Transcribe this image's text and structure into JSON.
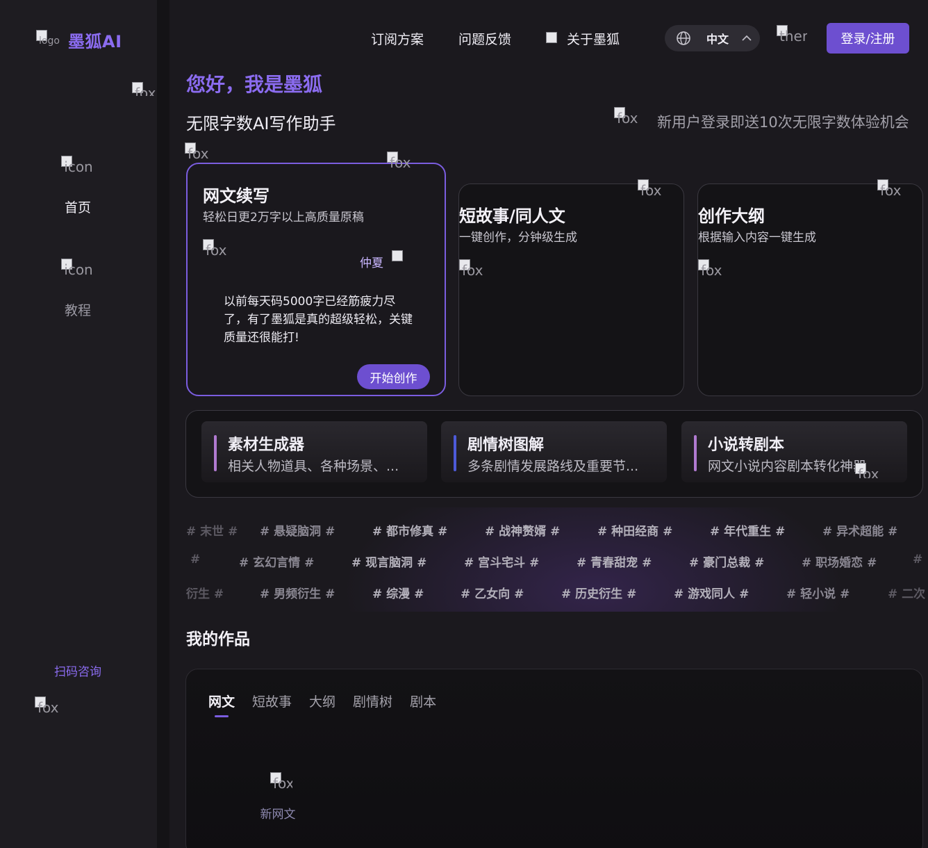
{
  "brand": {
    "name": "墨狐AI",
    "logo_alt": "logo"
  },
  "sidebar": {
    "items": [
      {
        "label": "首页",
        "icon_alt": "icon"
      },
      {
        "label": "教程",
        "icon_alt": "icon"
      }
    ],
    "consult_label": "扫码咨询",
    "consult_img_alt": "fox"
  },
  "header": {
    "nav": [
      "订阅方案",
      "问题反馈",
      "关于墨狐"
    ],
    "lang_label": "中文",
    "theme_alt": "ther",
    "login_label": "登录/注册"
  },
  "hero": {
    "greeting": "您好，我是墨狐",
    "subtitle": "无限字数AI写作助手",
    "promo": "新用户登录即送10次无限字数体验机会",
    "img_alt": "fox"
  },
  "cards": [
    {
      "title": "网文续写",
      "desc": "轻松日更2万字以上高质量原稿",
      "quote_name": "仲夏",
      "quote": "以前每天码5000字已经筋疲力尽了，有了墨狐是真的超级轻松，关键质量还很能打!",
      "button": "开始创作",
      "img_alt": "fox"
    },
    {
      "title": "短故事/同人文",
      "desc": "一键创作，分钟级生成",
      "img_alt": "fox"
    },
    {
      "title": "创作大纲",
      "desc": "根据输入内容一键生成",
      "img_alt": "fox"
    }
  ],
  "tools": [
    {
      "title": "素材生成器",
      "desc": "相关人物道具、各种场景、...",
      "accent": "#b07ad0"
    },
    {
      "title": "剧情树图解",
      "desc": "多条剧情发展路线及重要节...",
      "accent": "#4d5ad8"
    },
    {
      "title": "小说转剧本",
      "desc": "网文小说内容剧本转化神器",
      "accent": "#b07ad0"
    }
  ],
  "tags": {
    "row1": [
      "# 末世 #",
      "# 悬疑脑洞 #",
      "# 都市修真 #",
      "# 战神赘婿 #",
      "# 种田经商 #",
      "# 年代重生 #",
      "# 异术超能 #"
    ],
    "row2": [
      "#",
      "# 玄幻言情 #",
      "# 现言脑洞 #",
      "# 宫斗宅斗 #",
      "# 青春甜宠 #",
      "# 豪门总裁 #",
      "# 职场婚恋 #",
      "#"
    ],
    "row3": [
      "衍生 #",
      "# 男频衍生 #",
      "# 综漫 #",
      "# 乙女向 #",
      "# 历史衍生 #",
      "# 游戏同人 #",
      "# 轻小说 #",
      "# 二次"
    ]
  },
  "works": {
    "title": "我的作品",
    "tabs": [
      "网文",
      "短故事",
      "大纲",
      "剧情树",
      "剧本"
    ],
    "new_label": "新网文",
    "new_img_alt": "fox"
  },
  "colors": {
    "accent": "#7b5de0",
    "button": "#6d4fd0",
    "brand": "#8b6cf0"
  }
}
